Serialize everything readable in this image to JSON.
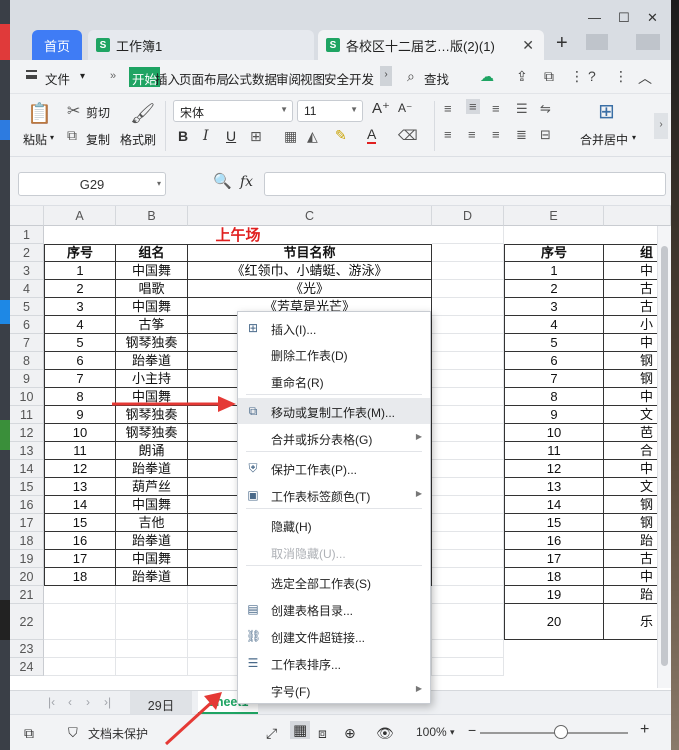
{
  "tabs": {
    "home": "首页",
    "doc1": "工作簿1",
    "doc2": "各校区十二届艺…版(2)(1)"
  },
  "menu": {
    "file": "文件",
    "items": [
      "开始",
      "插入",
      "页面布局",
      "公式",
      "数据",
      "审阅",
      "视图",
      "安全",
      "开发"
    ],
    "search": "查找"
  },
  "ribbon": {
    "paste": "粘贴",
    "cut": "剪切",
    "copy": "复制",
    "format_painter": "格式刷",
    "font": "宋体",
    "font_size": "11",
    "merge_center": "合并居中"
  },
  "formula": {
    "cell_ref": "G29",
    "fx": "fx"
  },
  "columns_left": [
    "A",
    "B",
    "C",
    "D"
  ],
  "columns_right": [
    "E"
  ],
  "title": "上午场",
  "headers": {
    "seq": "序号",
    "group": "组名",
    "program": "节目名称",
    "seq2": "序号",
    "group2_partial": "组"
  },
  "rows": [
    {
      "n": "3",
      "seq": "1",
      "group": "中国舞",
      "program": "《红领巾、小蜻蜓、游泳》"
    },
    {
      "n": "4",
      "seq": "2",
      "group": "唱歌",
      "program": "《光》"
    },
    {
      "n": "5",
      "seq": "3",
      "group": "中国舞",
      "program": "《芳草是光芒》"
    },
    {
      "n": "6",
      "seq": "4",
      "group": "古筝",
      "program": ""
    },
    {
      "n": "7",
      "seq": "5",
      "group": "钢琴独奏",
      "program": ""
    },
    {
      "n": "8",
      "seq": "6",
      "group": "跆拳道",
      "program": ""
    },
    {
      "n": "9",
      "seq": "7",
      "group": "小主持",
      "program": ""
    },
    {
      "n": "10",
      "seq": "8",
      "group": "中国舞",
      "program": "《小"
    },
    {
      "n": "11",
      "seq": "9",
      "group": "钢琴独奏",
      "program": ""
    },
    {
      "n": "12",
      "seq": "10",
      "group": "钢琴独奏",
      "program": ""
    },
    {
      "n": "13",
      "seq": "11",
      "group": "朗诵",
      "program": ""
    },
    {
      "n": "14",
      "seq": "12",
      "group": "跆拳道",
      "program": ""
    },
    {
      "n": "15",
      "seq": "13",
      "group": "葫芦丝",
      "program": ""
    },
    {
      "n": "16",
      "seq": "14",
      "group": "中国舞",
      "program": ""
    },
    {
      "n": "17",
      "seq": "15",
      "group": "吉他",
      "program": ""
    },
    {
      "n": "18",
      "seq": "16",
      "group": "跆拳道",
      "program": ""
    },
    {
      "n": "19",
      "seq": "17",
      "group": "中国舞",
      "program": ""
    },
    {
      "n": "20",
      "seq": "18",
      "group": "跆拳道",
      "program": ""
    }
  ],
  "right_rows": [
    {
      "seq": "1",
      "g": "中"
    },
    {
      "seq": "2",
      "g": "古"
    },
    {
      "seq": "3",
      "g": "古"
    },
    {
      "seq": "4",
      "g": "小"
    },
    {
      "seq": "5",
      "g": "中"
    },
    {
      "seq": "6",
      "g": "钢"
    },
    {
      "seq": "7",
      "g": "钢"
    },
    {
      "seq": "8",
      "g": "中"
    },
    {
      "seq": "9",
      "g": "文"
    },
    {
      "seq": "10",
      "g": "芭"
    },
    {
      "seq": "11",
      "g": "合"
    },
    {
      "seq": "12",
      "g": "中"
    },
    {
      "seq": "13",
      "g": "文"
    },
    {
      "seq": "14",
      "g": "钢"
    },
    {
      "seq": "15",
      "g": "钢"
    },
    {
      "seq": "16",
      "g": "跆"
    },
    {
      "seq": "17",
      "g": "古"
    },
    {
      "seq": "18",
      "g": "中"
    },
    {
      "seq": "19",
      "g": "跆"
    },
    {
      "seq": "20",
      "g": "乐"
    }
  ],
  "row_numbers": [
    "1",
    "2",
    "3",
    "4",
    "5",
    "6",
    "7",
    "8",
    "9",
    "10",
    "11",
    "12",
    "13",
    "14",
    "15",
    "16",
    "17",
    "18",
    "19",
    "20",
    "21",
    "22",
    "23",
    "24"
  ],
  "context_menu": [
    {
      "label": "插入(I)...",
      "icon": "insert-sheet-icon",
      "enabled": true,
      "submenu": false
    },
    {
      "label": "删除工作表(D)",
      "icon": "",
      "enabled": true,
      "submenu": false
    },
    {
      "label": "重命名(R)",
      "icon": "",
      "enabled": true,
      "submenu": false
    },
    {
      "label": "移动或复制工作表(M)...",
      "icon": "move-copy-icon",
      "enabled": true,
      "submenu": false
    },
    {
      "label": "合并或拆分表格(G)",
      "icon": "",
      "enabled": true,
      "submenu": true
    },
    {
      "label": "保护工作表(P)...",
      "icon": "protect-icon",
      "enabled": true,
      "submenu": false
    },
    {
      "label": "工作表标签颜色(T)",
      "icon": "tab-color-icon",
      "enabled": true,
      "submenu": true
    },
    {
      "label": "隐藏(H)",
      "icon": "",
      "enabled": true,
      "submenu": false
    },
    {
      "label": "取消隐藏(U)...",
      "icon": "",
      "enabled": false,
      "submenu": false
    },
    {
      "label": "选定全部工作表(S)",
      "icon": "",
      "enabled": true,
      "submenu": false
    },
    {
      "label": "创建表格目录...",
      "icon": "catalog-icon",
      "enabled": true,
      "submenu": false
    },
    {
      "label": "创建文件超链接...",
      "icon": "hyperlink-icon",
      "enabled": true,
      "submenu": false
    },
    {
      "label": "工作表排序...",
      "icon": "sort-sheets-icon",
      "enabled": true,
      "submenu": false
    },
    {
      "label": "字号(F)",
      "icon": "",
      "enabled": true,
      "submenu": true
    }
  ],
  "sheet_tabs": {
    "t1": "29日",
    "t2": "Sheet1"
  },
  "status": {
    "protect": "文档未保护",
    "zoom": "100%"
  },
  "colors": {
    "accent_green": "#1fa463",
    "home_blue": "#3f7cf5",
    "title_red": "#e02020",
    "arrow_red": "#e53935"
  }
}
